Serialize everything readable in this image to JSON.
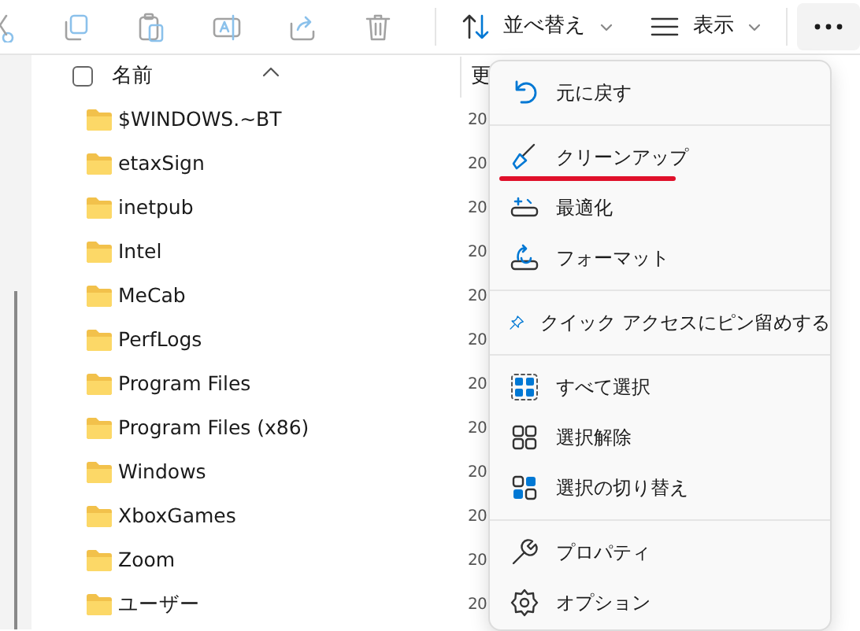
{
  "toolbar": {
    "icon_buttons": [
      {
        "disabled": true
      },
      {
        "disabled": true
      },
      {
        "disabled": true
      },
      {
        "disabled": true
      },
      {
        "disabled": true
      },
      {
        "disabled": true
      }
    ],
    "sort_button": {
      "label": "並べ替え"
    },
    "view_button": {
      "label": "表示"
    },
    "more_button": {
      "selected": true
    }
  },
  "file_list": {
    "header": {
      "name_column": "名前",
      "date_column": "更",
      "checked": false
    },
    "rows": [
      {
        "name": "$WINDOWS.~BT",
        "date": "20"
      },
      {
        "name": "etaxSign",
        "date": "20"
      },
      {
        "name": "inetpub",
        "date": "20"
      },
      {
        "name": "Intel",
        "date": "20"
      },
      {
        "name": "MeCab",
        "date": "20"
      },
      {
        "name": "PerfLogs",
        "date": "20"
      },
      {
        "name": "Program Files",
        "date": "20"
      },
      {
        "name": "Program Files (x86)",
        "date": "20"
      },
      {
        "name": "Windows",
        "date": "20"
      },
      {
        "name": "XboxGames",
        "date": "20"
      },
      {
        "name": "Zoom",
        "date": "20"
      },
      {
        "name": "ユーザー",
        "date": "20"
      }
    ]
  },
  "menu": {
    "groups": [
      [
        {
          "label": "元に戻す",
          "underlined": false
        }
      ],
      [
        {
          "label": "クリーンアップ",
          "underlined": true
        },
        {
          "label": "最適化",
          "underlined": false
        },
        {
          "label": "フォーマット",
          "underlined": false
        }
      ],
      [
        {
          "label": "クイック アクセスにピン留めする",
          "underlined": false
        }
      ],
      [
        {
          "label": "すべて選択",
          "underlined": false
        },
        {
          "label": "選択解除",
          "underlined": false
        },
        {
          "label": "選択の切り替え",
          "underlined": false
        }
      ],
      [
        {
          "label": "プロパティ",
          "underlined": false
        },
        {
          "label": "オプション",
          "underlined": false
        }
      ]
    ]
  }
}
